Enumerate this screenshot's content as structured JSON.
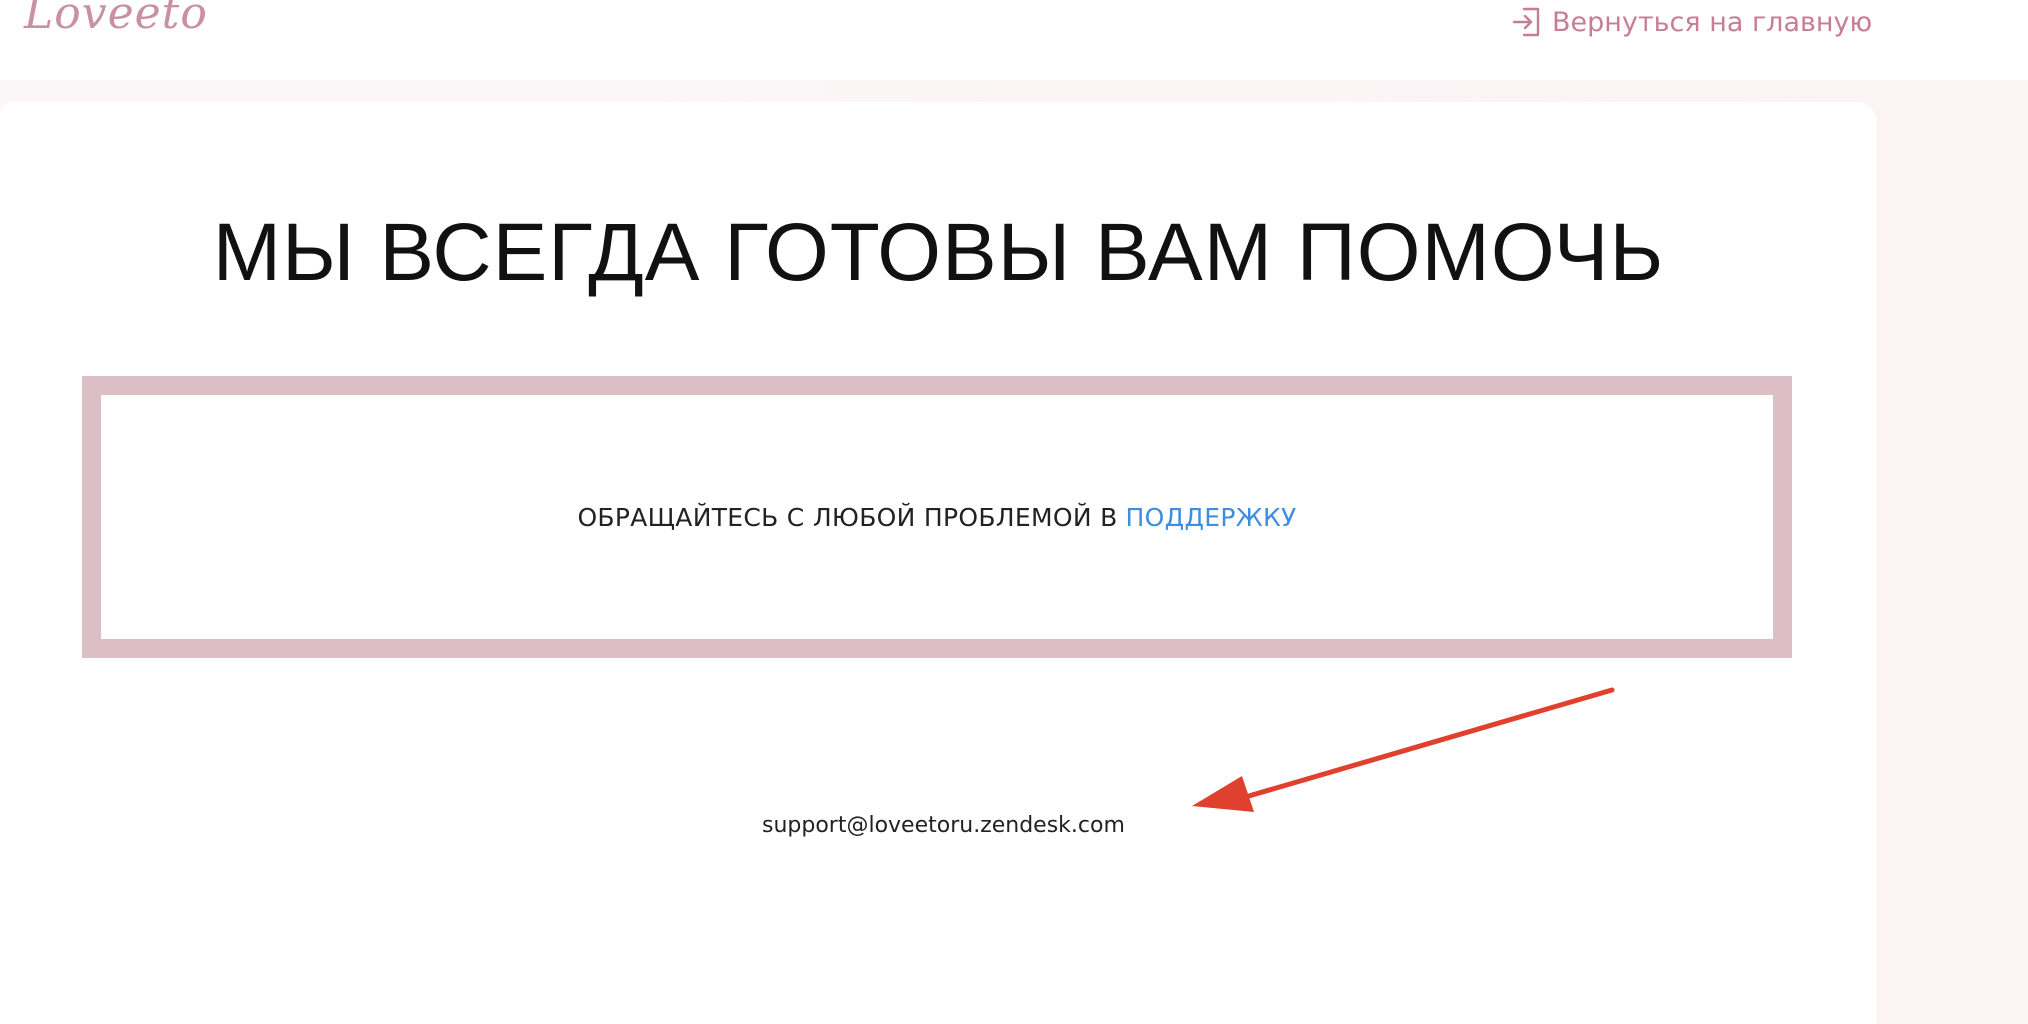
{
  "header": {
    "logo_text": "Loveeto",
    "back_label": "Вернуться на главную",
    "back_icon": "sign-in-icon",
    "accent_color": "#c77e95"
  },
  "main": {
    "heading": "МЫ ВСЕГДА ГОТОВЫ ВАМ ПОМОЧЬ",
    "notice_text": "ОБРАЩАЙТЕСЬ С ЛЮБОЙ ПРОБЛЕМОЙ В",
    "notice_link": "ПОДДЕРЖКУ",
    "link_color": "#3d8ee0",
    "frame_color": "#dcbec6",
    "email": "support@loveetoru.zendesk.com"
  },
  "annotation": {
    "icon": "red-arrow-icon",
    "color": "#e0412f"
  }
}
